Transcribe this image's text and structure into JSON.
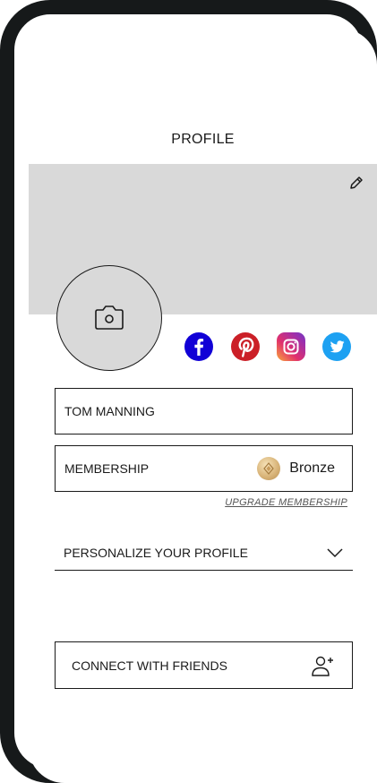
{
  "header": {
    "title": "PROFILE"
  },
  "profile": {
    "name": "TOM MANNING",
    "membership_label": "MEMBERSHIP",
    "membership_tier": "Bronze",
    "upgrade_link": "UPGRADE MEMBERSHIP"
  },
  "personalize": {
    "label": "PERSONALIZE YOUR PROFILE"
  },
  "connect": {
    "label": "CONNECT WITH FRIENDS"
  },
  "social": [
    {
      "icon": "facebook-icon",
      "color": "#1100d6"
    },
    {
      "icon": "pinterest-icon",
      "color": "#cb1f27"
    },
    {
      "icon": "instagram-icon",
      "color": "#c13584"
    },
    {
      "icon": "twitter-icon",
      "color": "#1da1f2"
    }
  ],
  "colors": {
    "cover": "#d9d9d9",
    "frame": "#16191a",
    "bronze": "#d9b57a"
  }
}
